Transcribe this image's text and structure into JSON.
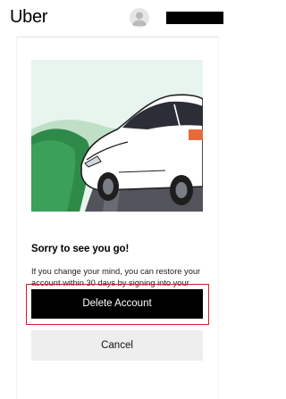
{
  "header": {
    "logo_text": "Uber"
  },
  "dialog": {
    "heading": "Sorry to see you go!",
    "body": "If you change your mind, you can restore your account within 30 days by signing into your Uber account.",
    "delete_label": "Delete Account",
    "cancel_label": "Cancel"
  },
  "colors": {
    "primary_button": "#000000",
    "highlight_border": "#d01e25",
    "secondary_button": "#eeeeee",
    "illustration_sky": "#e8f5ef",
    "illustration_grass": "#2f8a4a"
  }
}
